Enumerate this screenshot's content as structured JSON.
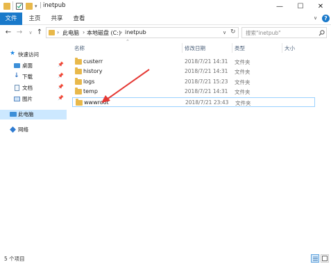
{
  "window": {
    "title": "inetpub",
    "quick_access_sep": "|",
    "minimize": "—",
    "maximize": "☐",
    "close": "✕"
  },
  "ribbon": {
    "tabs": [
      "文件",
      "主页",
      "共享",
      "查看"
    ],
    "help": "?",
    "collapse": "∨"
  },
  "address": {
    "crumbs": [
      "此电脑",
      "本地磁盘 (C:)",
      "inetpub"
    ],
    "search_placeholder": "搜索\"inetpub\""
  },
  "nav": {
    "items": [
      {
        "label": "快速访问"
      },
      {
        "label": "桌面"
      },
      {
        "label": "下载"
      },
      {
        "label": "文档"
      },
      {
        "label": "图片"
      },
      {
        "label": "此电脑"
      },
      {
        "label": "网络"
      }
    ]
  },
  "list": {
    "headers": [
      "名称",
      "修改日期",
      "类型",
      "大小"
    ],
    "rows": [
      {
        "name": "custerr",
        "date": "2018/7/21 14:31",
        "type": "文件夹"
      },
      {
        "name": "history",
        "date": "2018/7/21 14:31",
        "type": "文件夹"
      },
      {
        "name": "logs",
        "date": "2018/7/21 15:23",
        "type": "文件夹"
      },
      {
        "name": "temp",
        "date": "2018/7/21 14:31",
        "type": "文件夹"
      },
      {
        "name": "wwwroot",
        "date": "2018/7/21 23:43",
        "type": "文件夹"
      }
    ]
  },
  "status": {
    "count": "5 个项目"
  },
  "colors": {
    "accent": "#1979ca",
    "arrow": "#e53935",
    "selection": "#cce8ff",
    "folder": "#e8b84a"
  }
}
